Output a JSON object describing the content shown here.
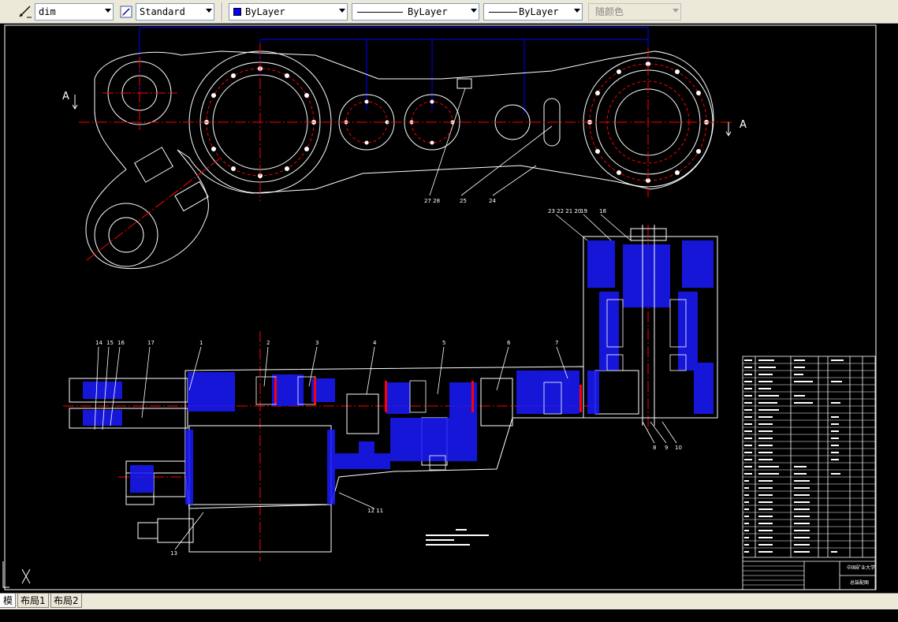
{
  "toolbar": {
    "dimstyle_value": "dim",
    "textstyle_value": "Standard",
    "color_value": "ByLayer",
    "linetype_value": "ByLayer",
    "lineweight_value": "ByLayer",
    "plotstyle_value": "随颜色"
  },
  "drawing": {
    "section_label": "A",
    "callouts_top": [
      "27 28",
      "25",
      "24"
    ],
    "callouts_upper_right": [
      "23 22 21 20",
      "19",
      "18"
    ],
    "callouts_main": [
      "14",
      "15",
      "16",
      "17",
      "1",
      "2",
      "3",
      "4",
      "5",
      "6",
      "7"
    ],
    "callouts_lower": [
      "8",
      "9",
      "10",
      "12 11",
      "13"
    ],
    "title_block": {
      "school": "中国矿业大学",
      "drawing_name": "总装配图"
    }
  },
  "tabs": [
    {
      "label": "模型"
    },
    {
      "label": "布局1"
    },
    {
      "label": "布局2"
    }
  ],
  "colors": {
    "canvas": "#000000",
    "geometry": "#ffffff",
    "centerline": "#ff0000",
    "hatch": "#0000ff",
    "dims": "#0000ff"
  }
}
